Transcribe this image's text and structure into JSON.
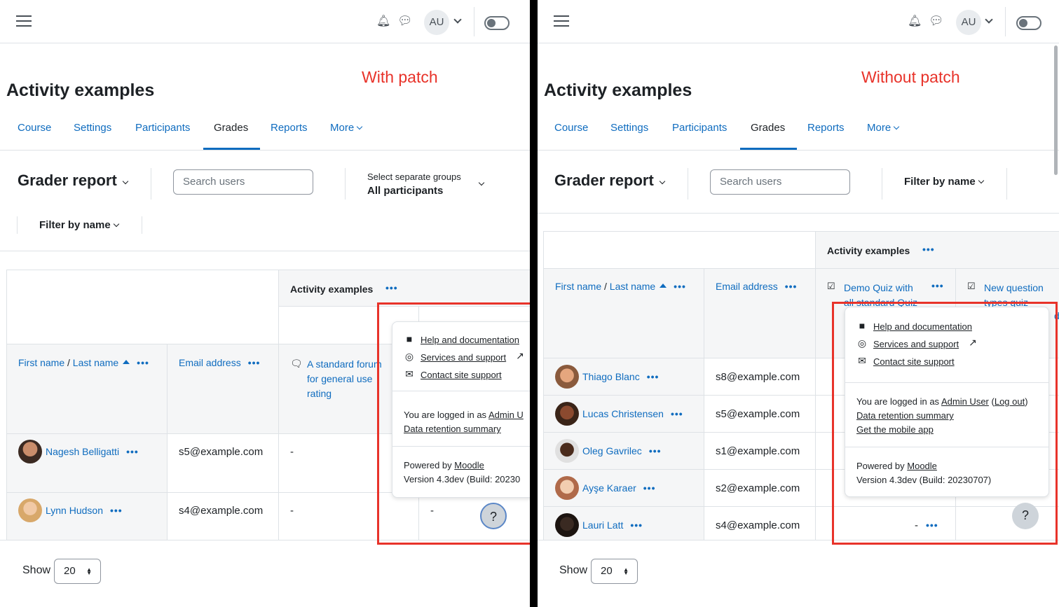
{
  "header": {
    "avatar_initials": "AU"
  },
  "left": {
    "annotation": "With patch",
    "page_title": "Activity examples",
    "nav": [
      "Course",
      "Settings",
      "Participants",
      "Grades",
      "Reports",
      "More"
    ],
    "report_title": "Grader report",
    "search_placeholder": "Search users",
    "groups_label": "Select separate groups",
    "groups_value": "All participants",
    "filter_label": "Filter by name",
    "category": "Activity examples",
    "col_first": "First name",
    "col_sep": " / ",
    "col_last": "Last name",
    "col_email": "Email address",
    "col_forum": [
      "A standard forum",
      "for general use",
      "rating"
    ],
    "rows": [
      {
        "name": "Nagesh Belligatti",
        "email": "s5@example.com",
        "grade": "-"
      },
      {
        "name": "Lynn Hudson",
        "email": "s4@example.com",
        "grade": "-",
        "grade2": "-"
      }
    ],
    "popover": {
      "help": "Help and documentation",
      "services": "Services and support",
      "contact": "Contact site support",
      "logged_prefix": "You are logged in as ",
      "logged_user": "Admin U",
      "retention": "Data retention summary",
      "powered_prefix": "Powered by ",
      "powered_link": "Moodle",
      "version": "Version 4.3dev (Build: 20230"
    },
    "show_label": "Show",
    "show_value": "20",
    "help_button": "?"
  },
  "right": {
    "annotation": "Without patch",
    "page_title": "Activity examples",
    "nav": [
      "Course",
      "Settings",
      "Participants",
      "Grades",
      "Reports",
      "More"
    ],
    "report_title": "Grader report",
    "search_placeholder": "Search users",
    "filter_label": "Filter by name",
    "category": "Activity examples",
    "col_first": "First name",
    "col_sep": " / ",
    "col_last": "Last name",
    "col_email": "Email address",
    "col_quiz": [
      "Demo Quiz with",
      "all standard Quiz"
    ],
    "col_newq": [
      "New question",
      "types quiz -"
    ],
    "col_newq_tail": "d",
    "rows": [
      {
        "name": "Thiago Blanc",
        "email": "s8@example.com"
      },
      {
        "name": "Lucas Christensen",
        "email": "s5@example.com"
      },
      {
        "name": "Oleg Gavrilec",
        "email": "s1@example.com"
      },
      {
        "name": "Ayşe Karaer",
        "email": "s2@example.com"
      },
      {
        "name": "Lauri Latt",
        "email": "s4@example.com",
        "grade": "-"
      }
    ],
    "popover": {
      "help": "Help and documentation",
      "services": "Services and support",
      "contact": "Contact site support",
      "logged_prefix": "You are logged in as ",
      "logged_user": "Admin User",
      "logout_open": " (",
      "logout": "Log out",
      "logout_close": ")",
      "retention": "Data retention summary",
      "mobile": "Get the mobile app",
      "powered_prefix": "Powered by ",
      "powered_link": "Moodle",
      "version": "Version 4.3dev (Build: 20230707)"
    },
    "show_label": "Show",
    "show_value": "20",
    "help_button": "?"
  },
  "colors": {
    "link": "#0f6cbf",
    "annotation": "#e8332a",
    "highlight_box": "#e8332a"
  }
}
